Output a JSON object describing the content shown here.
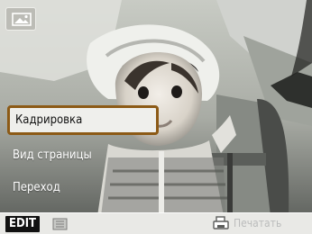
{
  "screen": {
    "icon": "image-icon"
  },
  "menu": {
    "items": [
      {
        "label": "Кадрировка",
        "selected": true
      },
      {
        "label": "Вид страницы",
        "selected": false
      },
      {
        "label": "Переход",
        "selected": false
      }
    ]
  },
  "bottom_bar": {
    "edit_label": "EDIT",
    "print_label": "Печатать",
    "edit_icon": "menu-list-icon",
    "print_icon": "printer-icon"
  },
  "colors": {
    "menu_highlight_border": "#8c5a16",
    "menu_highlight_bg": "#efefec",
    "bottom_bar_bg": "#e9e9e6"
  }
}
